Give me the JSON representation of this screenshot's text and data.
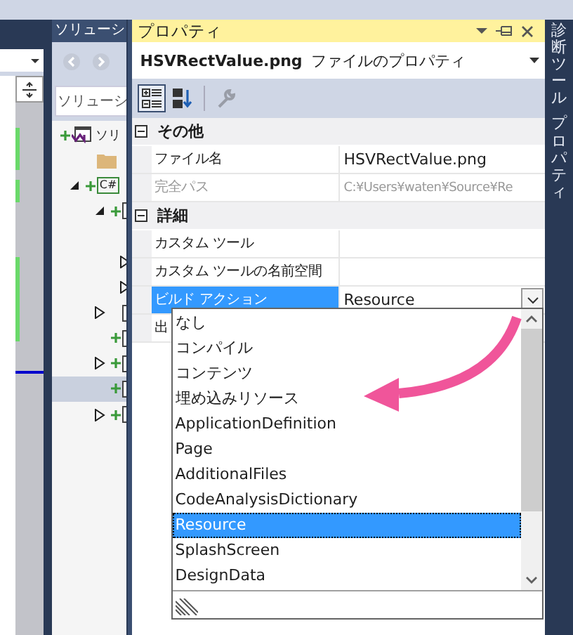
{
  "solution_explorer": {
    "title": "ソリューシ",
    "search": {
      "placeholder": "ソリューシ"
    },
    "tree": [
      {
        "kind": "solution",
        "label": "ソリ",
        "expandable": false,
        "added": true,
        "selected": false,
        "children": [
          {
            "kind": "folder",
            "expandable": false,
            "added": false,
            "selected": false
          },
          {
            "kind": "csharp",
            "badge": "C#",
            "expandable": true,
            "expanded": true,
            "added": true,
            "selected": false,
            "children": [
              {
                "kind": "item",
                "expandable": true,
                "expanded": true,
                "added": true,
                "selected": false,
                "children": [
                  {
                    "selected": false
                  },
                  {
                    "expandable": true,
                    "expanded": false,
                    "selected": false
                  },
                  {
                    "expandable": true,
                    "expanded": false,
                    "selected": false
                  }
                ]
              },
              {
                "kind": "item",
                "expandable": true,
                "expanded": false,
                "added": false,
                "selected": false
              },
              {
                "kind": "item",
                "expandable": false,
                "added": true,
                "selected": false
              },
              {
                "kind": "item",
                "expandable": true,
                "expanded": false,
                "added": true,
                "selected": false
              },
              {
                "kind": "item",
                "expandable": false,
                "added": true,
                "selected": true
              },
              {
                "kind": "item",
                "expandable": true,
                "expanded": false,
                "added": true,
                "selected": false
              }
            ]
          }
        ]
      }
    ]
  },
  "properties": {
    "title": "プロパティ",
    "object": "HSVRectValue.png",
    "object_type": "ファイルのプロパティ",
    "toolbar": [
      {
        "kind": "categorized",
        "selected": true
      },
      {
        "kind": "alphabetical",
        "selected": false
      },
      {
        "kind": "pages",
        "disabled": true
      }
    ],
    "categories": [
      {
        "name": "その他",
        "expanded": true,
        "rows": [
          {
            "name": "ファイル名",
            "value": "HSVRectValue.png",
            "readonly": false,
            "selected": false
          },
          {
            "name": "完全パス",
            "value": "C:¥Users¥waten¥Source¥Re",
            "readonly": true,
            "selected": false
          }
        ]
      },
      {
        "name": "詳細",
        "expanded": true,
        "rows": [
          {
            "name": "カスタム ツール",
            "readonly": false,
            "selected": false
          },
          {
            "name": "カスタム ツールの名前空間",
            "readonly": false,
            "selected": false
          },
          {
            "name": "ビルド アクション",
            "value": "Resource",
            "readonly": false,
            "selected": true,
            "dropdown": true
          },
          {
            "name": "出",
            "readonly": false,
            "selected": false
          }
        ]
      }
    ],
    "dropdown": {
      "items": [
        {
          "label": "なし",
          "selected": false
        },
        {
          "label": "コンパイル",
          "selected": false
        },
        {
          "label": "コンテンツ",
          "selected": false
        },
        {
          "label": "埋め込みリソース",
          "selected": false
        },
        {
          "label": "ApplicationDefinition",
          "selected": false
        },
        {
          "label": "Page",
          "selected": false
        },
        {
          "label": "AdditionalFiles",
          "selected": false
        },
        {
          "label": "CodeAnalysisDictionary",
          "selected": false
        },
        {
          "label": "Resource",
          "selected": true
        },
        {
          "label": "SplashScreen",
          "selected": false
        },
        {
          "label": "DesignData",
          "selected": false
        }
      ]
    }
  },
  "side_tabs": [
    "診断ツール",
    "プロパティ"
  ]
}
